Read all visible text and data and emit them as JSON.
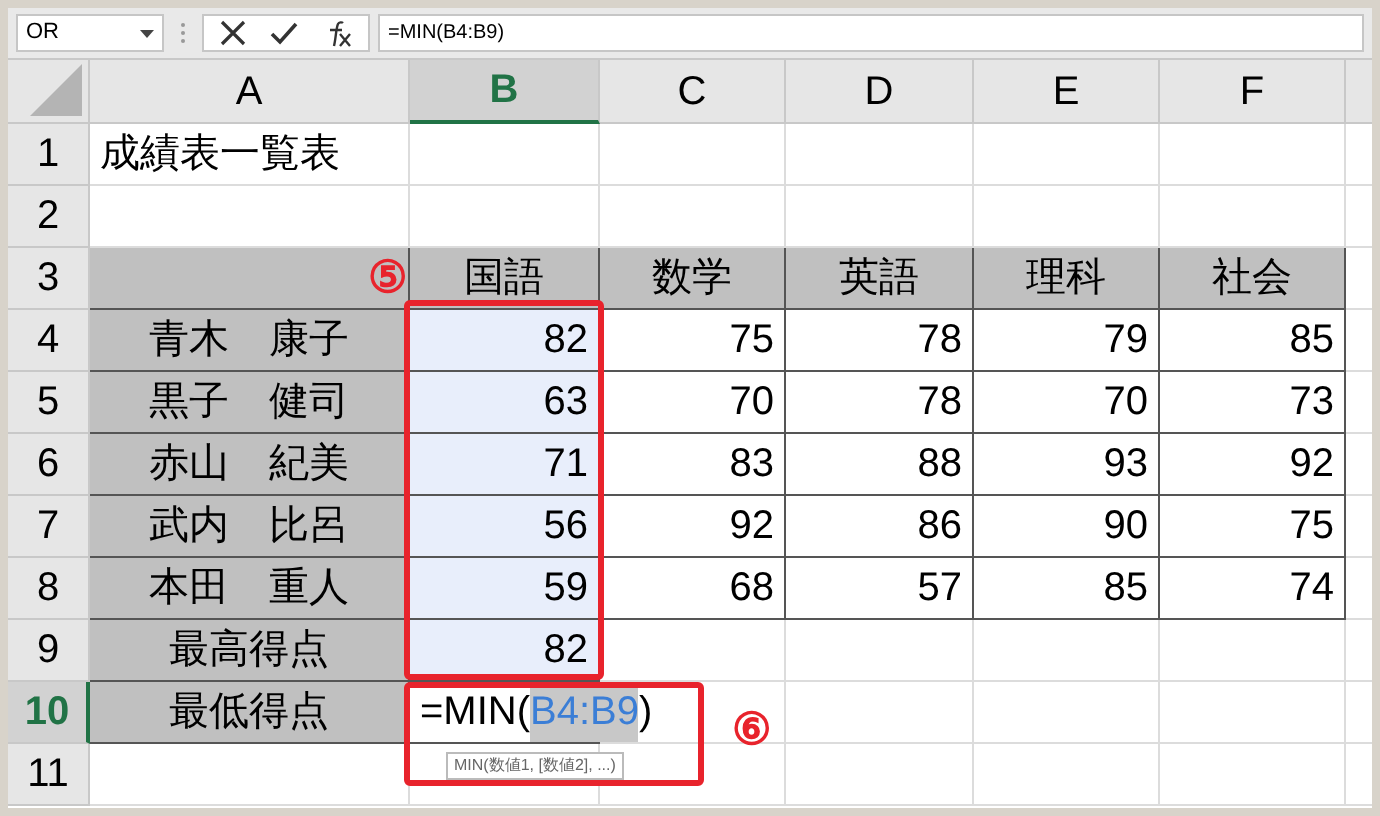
{
  "name_box": "OR",
  "formula": "=MIN(B4:B9)",
  "columns": [
    {
      "label": "A",
      "selected": false
    },
    {
      "label": "B",
      "selected": true
    },
    {
      "label": "C",
      "selected": false
    },
    {
      "label": "D",
      "selected": false
    },
    {
      "label": "E",
      "selected": false
    },
    {
      "label": "F",
      "selected": false
    }
  ],
  "rows": [
    {
      "label": "1",
      "selected": false,
      "cells": {
        "A": "成績表一覧表"
      }
    },
    {
      "label": "2",
      "selected": false,
      "cells": {}
    },
    {
      "label": "3",
      "selected": false,
      "cells": {
        "B": "国語",
        "C": "数学",
        "D": "英語",
        "E": "理科",
        "F": "社会"
      }
    },
    {
      "label": "4",
      "selected": false,
      "cells": {
        "A": "青木　康子",
        "B": {
          "text": "82",
          "referenced": true
        },
        "C": "75",
        "D": "78",
        "E": "79",
        "F": "85"
      }
    },
    {
      "label": "5",
      "selected": false,
      "cells": {
        "A": "黒子　健司",
        "B": {
          "text": "63",
          "referenced": true
        },
        "C": "70",
        "D": "78",
        "E": "70",
        "F": "73"
      }
    },
    {
      "label": "6",
      "selected": false,
      "cells": {
        "A": "赤山　紀美",
        "B": {
          "text": "71",
          "referenced": true
        },
        "C": "83",
        "D": "88",
        "E": "93",
        "F": "92"
      }
    },
    {
      "label": "7",
      "selected": false,
      "cells": {
        "A": "武内　比呂",
        "B": {
          "text": "56",
          "referenced": true
        },
        "C": "92",
        "D": "86",
        "E": "90",
        "F": "75"
      }
    },
    {
      "label": "8",
      "selected": false,
      "cells": {
        "A": "本田　重人",
        "B": {
          "text": "59",
          "referenced": true
        },
        "C": "68",
        "D": "57",
        "E": "85",
        "F": "74"
      }
    },
    {
      "label": "9",
      "selected": false,
      "cells": {
        "A": "最高得点",
        "B": {
          "text": "82",
          "referenced": true
        }
      }
    },
    {
      "label": "10",
      "selected": true,
      "cells": {
        "A": "最低得点",
        "B": {
          "kind": "editing",
          "prefix": "=MIN(",
          "ref": "B4:B9",
          "suffix": ")",
          "tooltip": "MIN(数値1, [数値2], ...)"
        }
      }
    },
    {
      "label": "11",
      "selected": false,
      "cells": {}
    }
  ],
  "annotations": [
    {
      "label": "⑤"
    },
    {
      "label": "⑥"
    }
  ]
}
